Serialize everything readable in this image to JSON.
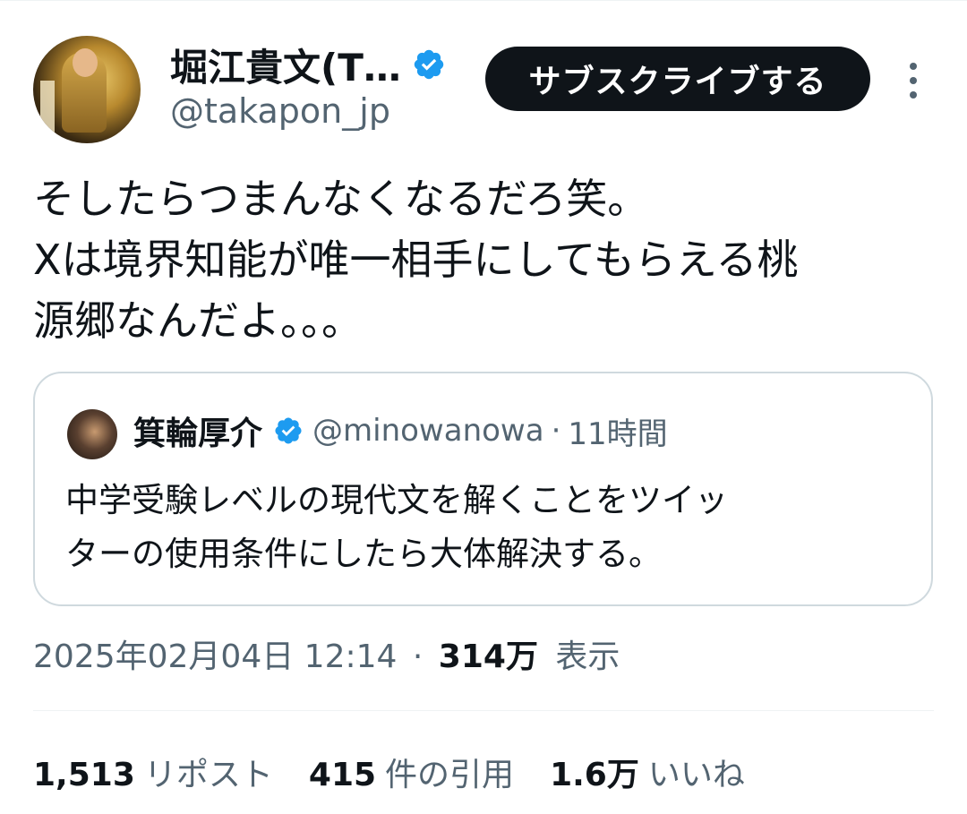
{
  "tweet": {
    "author_name": "堀江貴文(T…",
    "author_handle": "@takapon_jp",
    "subscribe_label": "サブスクライブする",
    "text": "そしたらつまんなくなるだろ笑。\nXは境界知能が唯一相手にしてもらえる桃\n源郷なんだよ。。。",
    "timestamp": "2025年02月04日 12:14",
    "separator": "·",
    "views_count": "314万",
    "views_label": "表示"
  },
  "quoted": {
    "author_name": "箕輪厚介",
    "author_handle": "@minowanowa",
    "separator": "·",
    "age": "11時間",
    "text": "中学受験レベルの現代文を解くことをツイッ\nターの使用条件にしたら大体解決する。"
  },
  "stats": {
    "reposts_count": "1,513",
    "reposts_label": "リポスト",
    "quotes_count": "415",
    "quotes_label": "件の引用",
    "likes_count": "1.6万",
    "likes_label": "いいね"
  },
  "colors": {
    "text_primary": "#0f1419",
    "text_secondary": "#536471",
    "verified_blue": "#1d9bf0",
    "border": "#cfd9de"
  },
  "icons": {
    "verified": "verified-badge-icon",
    "more": "more-vertical-icon"
  }
}
